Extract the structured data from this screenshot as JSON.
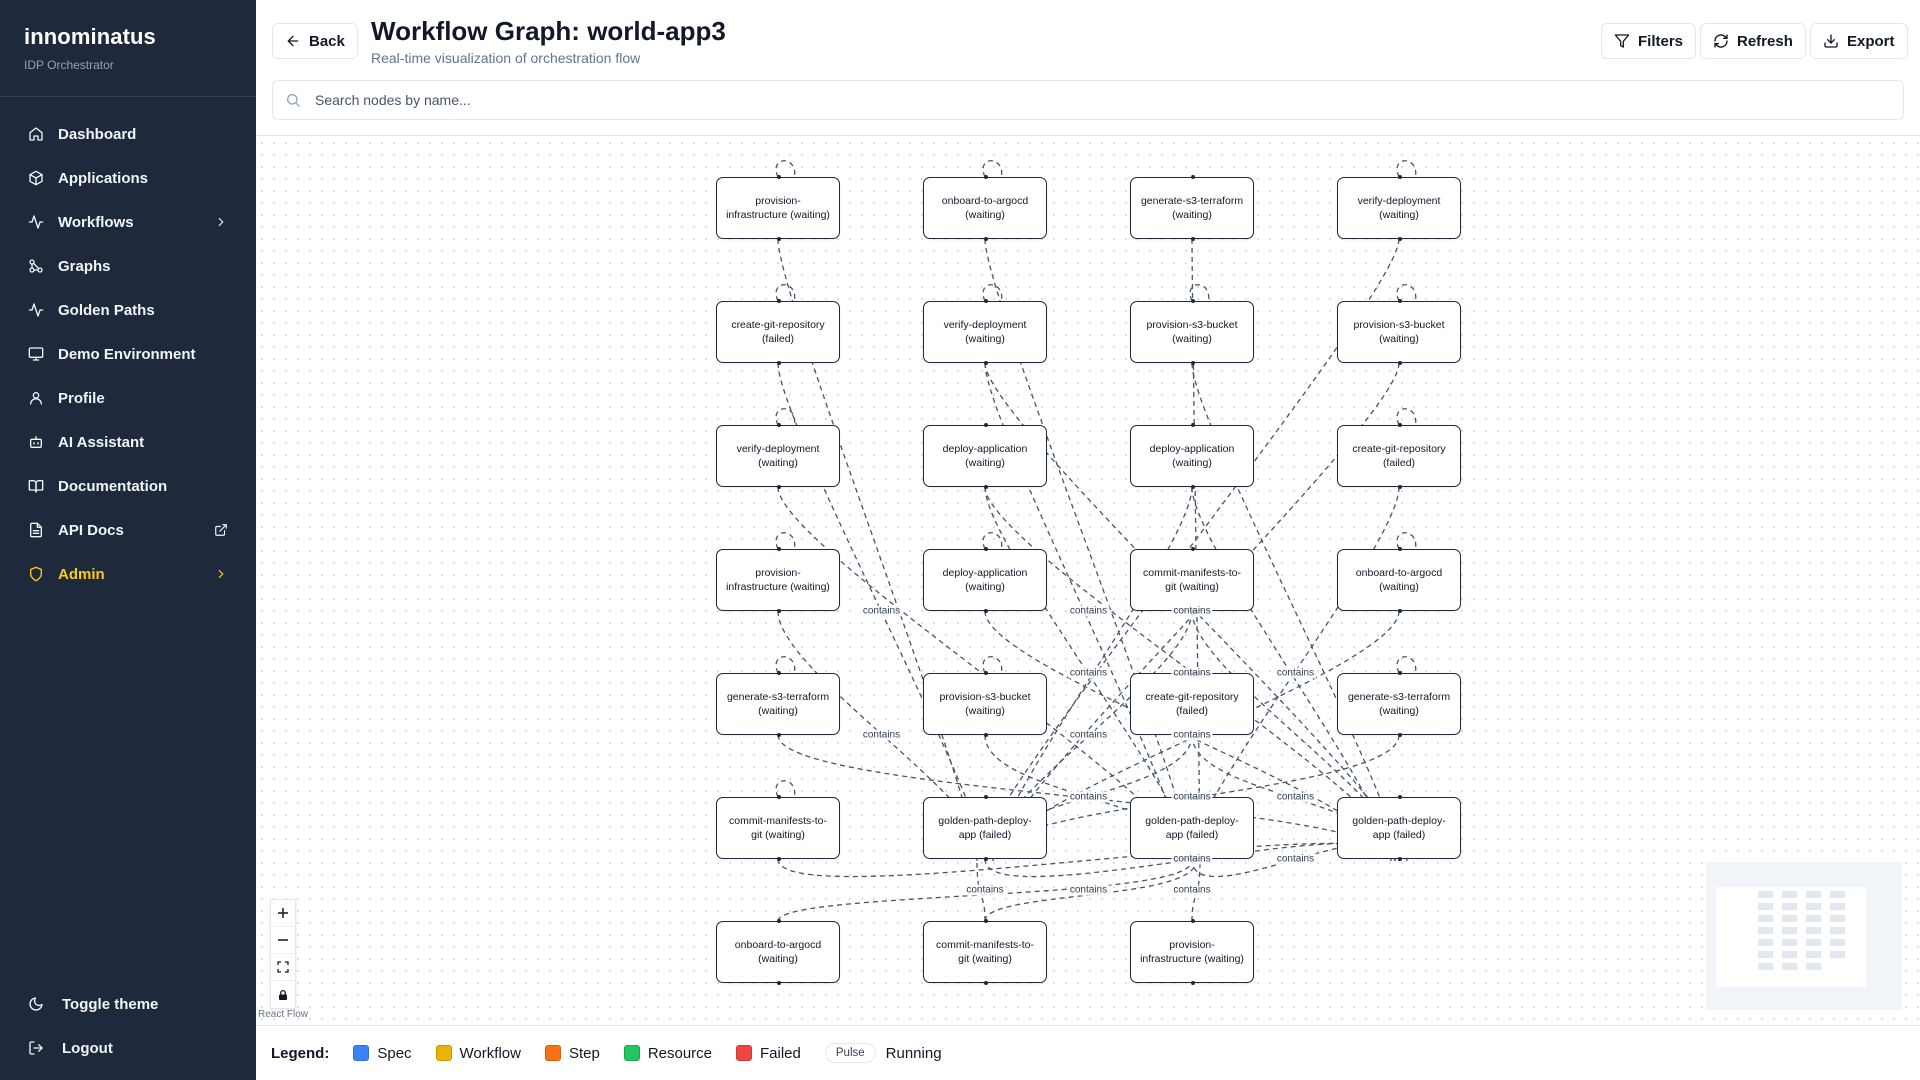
{
  "brand": {
    "title": "innominatus",
    "subtitle": "IDP Orchestrator"
  },
  "nav": [
    {
      "label": "Dashboard",
      "icon": "home-icon"
    },
    {
      "label": "Applications",
      "icon": "package-icon"
    },
    {
      "label": "Workflows",
      "icon": "activity-icon",
      "has_chevron": true
    },
    {
      "label": "Graphs",
      "icon": "graph-icon"
    },
    {
      "label": "Golden Paths",
      "icon": "activity-icon"
    },
    {
      "label": "Demo Environment",
      "icon": "monitor-icon"
    },
    {
      "label": "Profile",
      "icon": "user-icon"
    },
    {
      "label": "AI Assistant",
      "icon": "bot-icon"
    },
    {
      "label": "Documentation",
      "icon": "book-icon"
    },
    {
      "label": "API Docs",
      "icon": "file-icon",
      "external": true
    },
    {
      "label": "Admin",
      "icon": "shield-icon",
      "has_chevron": true,
      "accent": "#facc15"
    }
  ],
  "sidebar_bottom": {
    "toggle_theme": "Toggle theme",
    "logout": "Logout"
  },
  "header": {
    "back_label": "Back",
    "title": "Workflow Graph: world-app3",
    "subtitle": "Real-time visualization of orchestration flow",
    "filters_label": "Filters",
    "refresh_label": "Refresh",
    "export_label": "Export"
  },
  "search": {
    "placeholder": "Search nodes by name..."
  },
  "graph": {
    "nodes": [
      {
        "id": "n00",
        "label": "provision-infrastructure (waiting)",
        "status": "waiting"
      },
      {
        "id": "n01",
        "label": "onboard-to-argocd (waiting)",
        "status": "waiting"
      },
      {
        "id": "n02",
        "label": "generate-s3-terraform (waiting)",
        "status": "waiting"
      },
      {
        "id": "n03",
        "label": "verify-deployment (waiting)",
        "status": "waiting"
      },
      {
        "id": "n10",
        "label": "create-git-repository (failed)",
        "status": "failed"
      },
      {
        "id": "n11",
        "label": "verify-deployment (waiting)",
        "status": "waiting"
      },
      {
        "id": "n12",
        "label": "provision-s3-bucket (waiting)",
        "status": "waiting"
      },
      {
        "id": "n13",
        "label": "provision-s3-bucket (waiting)",
        "status": "waiting"
      },
      {
        "id": "n20",
        "label": "verify-deployment (waiting)",
        "status": "waiting"
      },
      {
        "id": "n21",
        "label": "deploy-application (waiting)",
        "status": "waiting"
      },
      {
        "id": "n22",
        "label": "deploy-application (waiting)",
        "status": "waiting"
      },
      {
        "id": "n23",
        "label": "create-git-repository (failed)",
        "status": "failed"
      },
      {
        "id": "n30",
        "label": "provision-infrastructure (waiting)",
        "status": "waiting"
      },
      {
        "id": "n31",
        "label": "deploy-application (waiting)",
        "status": "waiting"
      },
      {
        "id": "n32",
        "label": "commit-manifests-to-git (waiting)",
        "status": "waiting"
      },
      {
        "id": "n33",
        "label": "onboard-to-argocd (waiting)",
        "status": "waiting"
      },
      {
        "id": "n40",
        "label": "generate-s3-terraform (waiting)",
        "status": "waiting"
      },
      {
        "id": "n41",
        "label": "provision-s3-bucket (waiting)",
        "status": "waiting"
      },
      {
        "id": "n42",
        "label": "create-git-repository (failed)",
        "status": "failed"
      },
      {
        "id": "n43",
        "label": "generate-s3-terraform (waiting)",
        "status": "waiting"
      },
      {
        "id": "n50",
        "label": "commit-manifests-to-git (waiting)",
        "status": "waiting"
      },
      {
        "id": "n51",
        "label": "golden-path-deploy-app (failed)",
        "status": "failed"
      },
      {
        "id": "n52",
        "label": "golden-path-deploy-app (failed)",
        "status": "failed"
      },
      {
        "id": "n53",
        "label": "golden-path-deploy-app (failed)",
        "status": "failed"
      },
      {
        "id": "n60",
        "label": "onboard-to-argocd (waiting)",
        "status": "waiting"
      },
      {
        "id": "n61",
        "label": "commit-manifests-to-git (waiting)",
        "status": "waiting"
      },
      {
        "id": "n62",
        "label": "provision-infrastructure (waiting)",
        "status": "waiting"
      }
    ],
    "edges": [
      {
        "from": "n00",
        "to": "n51",
        "label": ""
      },
      {
        "from": "n00",
        "to": "n00",
        "label": ""
      },
      {
        "from": "n01",
        "to": "n52",
        "label": ""
      },
      {
        "from": "n01",
        "to": "n01",
        "label": ""
      },
      {
        "from": "n02",
        "to": "n52",
        "label": ""
      },
      {
        "from": "n03",
        "to": "n51",
        "label": ""
      },
      {
        "from": "n03",
        "to": "n03",
        "label": ""
      },
      {
        "from": "n10",
        "to": "n51",
        "label": "contains"
      },
      {
        "from": "n10",
        "to": "n10",
        "label": ""
      },
      {
        "from": "n11",
        "to": "n53",
        "label": ""
      },
      {
        "from": "n11",
        "to": "n52",
        "label": "contains"
      },
      {
        "from": "n11",
        "to": "n11",
        "label": ""
      },
      {
        "from": "n12",
        "to": "n53",
        "label": ""
      },
      {
        "from": "n12",
        "to": "n12",
        "label": ""
      },
      {
        "from": "n13",
        "to": "n51",
        "label": "contains"
      },
      {
        "from": "n13",
        "to": "n13",
        "label": ""
      },
      {
        "from": "n20",
        "to": "n52",
        "label": ""
      },
      {
        "from": "n20",
        "to": "n20",
        "label": ""
      },
      {
        "from": "n21",
        "to": "n53",
        "label": "contains"
      },
      {
        "from": "n22",
        "to": "n51",
        "label": "contains"
      },
      {
        "from": "n22",
        "to": "n53",
        "label": ""
      },
      {
        "from": "n23",
        "to": "n52",
        "label": "contains"
      },
      {
        "from": "n23",
        "to": "n23",
        "label": ""
      },
      {
        "from": "n30",
        "to": "n51",
        "label": "contains"
      },
      {
        "from": "n30",
        "to": "n30",
        "label": ""
      },
      {
        "from": "n31",
        "to": "n53",
        "label": "contains"
      },
      {
        "from": "n31",
        "to": "n31",
        "label": ""
      },
      {
        "from": "n32",
        "to": "n51",
        "label": "contains"
      },
      {
        "from": "n32",
        "to": "n53",
        "label": ""
      },
      {
        "from": "n33",
        "to": "n51",
        "label": "contains"
      },
      {
        "from": "n33",
        "to": "n33",
        "label": ""
      },
      {
        "from": "n40",
        "to": "n53",
        "label": ""
      },
      {
        "from": "n40",
        "to": "n40",
        "label": ""
      },
      {
        "from": "n41",
        "to": "n52",
        "label": "contains"
      },
      {
        "from": "n41",
        "to": "n41",
        "label": ""
      },
      {
        "from": "n42",
        "to": "n51",
        "label": "contains"
      },
      {
        "from": "n42",
        "to": "n53",
        "label": "contains"
      },
      {
        "from": "n43",
        "to": "n51",
        "label": "contains"
      },
      {
        "from": "n43",
        "to": "n43",
        "label": ""
      },
      {
        "from": "n50",
        "to": "n53",
        "label": ""
      },
      {
        "from": "n50",
        "to": "n50",
        "label": ""
      },
      {
        "from": "n51",
        "to": "n53",
        "label": "contains"
      },
      {
        "from": "n60",
        "to": "n52",
        "label": "contains"
      },
      {
        "from": "n61",
        "to": "n52",
        "label": "contains"
      },
      {
        "from": "n62",
        "to": "n52",
        "label": "contains"
      },
      {
        "from": "n61",
        "to": "n51",
        "label": ""
      },
      {
        "from": "n52",
        "to": "n53",
        "label": "contains"
      },
      {
        "from": "n21",
        "to": "n52",
        "label": ""
      }
    ]
  },
  "flow": {
    "attribution": "React Flow"
  },
  "legend": {
    "title": "Legend:",
    "items": [
      {
        "label": "Spec",
        "color": "#3b82f6"
      },
      {
        "label": "Workflow",
        "color": "#eab308"
      },
      {
        "label": "Step",
        "color": "#f97316"
      },
      {
        "label": "Resource",
        "color": "#22c55e"
      },
      {
        "label": "Failed",
        "color": "#ef4444"
      }
    ],
    "pulse_label": "Pulse",
    "running_label": "Running"
  }
}
